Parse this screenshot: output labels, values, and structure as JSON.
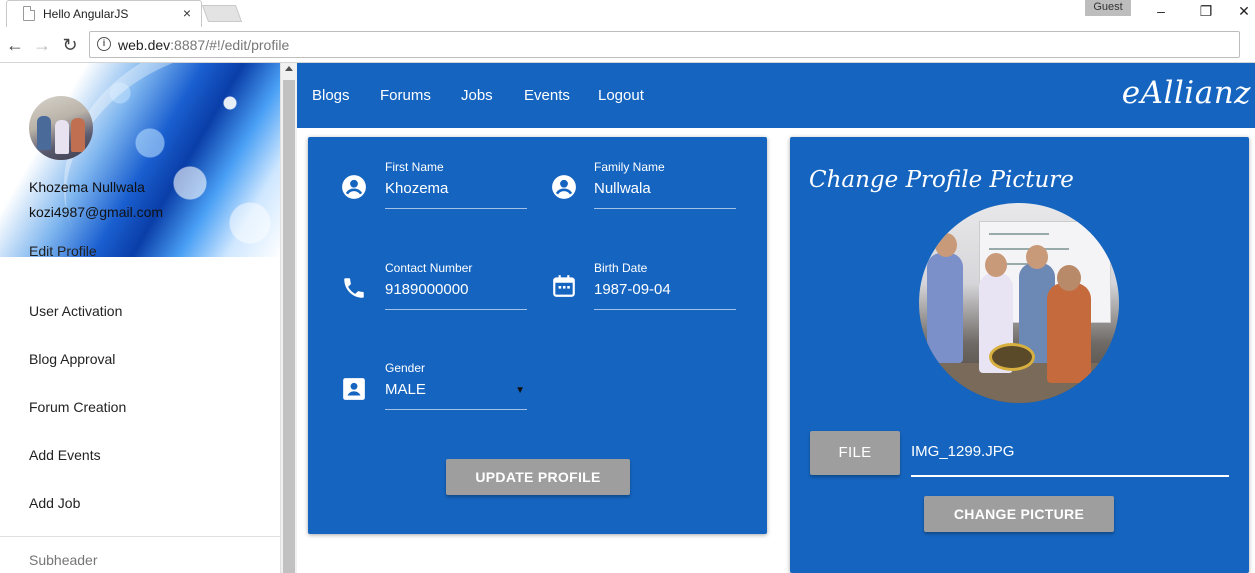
{
  "browser": {
    "tab_title": "Hello AngularJS",
    "tab_close": "×",
    "profile_label": "Guest",
    "url_host": "web.dev",
    "url_rest": ":8887/#!/edit/profile"
  },
  "sidebar": {
    "user_name": "Khozema Nullwala",
    "user_email": "kozi4987@gmail.com",
    "edit_profile": "Edit Profile",
    "items": [
      {
        "label": "User Activation"
      },
      {
        "label": "Blog Approval"
      },
      {
        "label": "Forum Creation"
      },
      {
        "label": "Add Events"
      },
      {
        "label": "Add Job"
      }
    ],
    "subheader": "Subheader"
  },
  "nav": {
    "links": [
      {
        "label": "Blogs"
      },
      {
        "label": "Forums"
      },
      {
        "label": "Jobs"
      },
      {
        "label": "Events"
      },
      {
        "label": "Logout"
      }
    ],
    "brand": "eAllianz"
  },
  "profile_form": {
    "first_name": {
      "label": "First Name",
      "value": "Khozema",
      "icon": "account-circle-icon"
    },
    "family_name": {
      "label": "Family Name",
      "value": "Nullwala",
      "icon": "account-circle-icon"
    },
    "contact": {
      "label": "Contact Number",
      "value": "9189000000",
      "icon": "phone-icon"
    },
    "birth_date": {
      "label": "Birth Date",
      "value": "1987-09-04",
      "icon": "calendar-icon"
    },
    "gender": {
      "label": "Gender",
      "value": "MALE",
      "icon": "contact-card-icon"
    },
    "update_button": "UPDATE PROFILE"
  },
  "picture_card": {
    "title": "Change Profile Picture",
    "file_button": "FILE",
    "file_name": "IMG_1299.JPG",
    "change_button": "CHANGE PICTURE"
  },
  "colors": {
    "primary": "#1565c0",
    "button_grey": "#9e9e9e"
  }
}
